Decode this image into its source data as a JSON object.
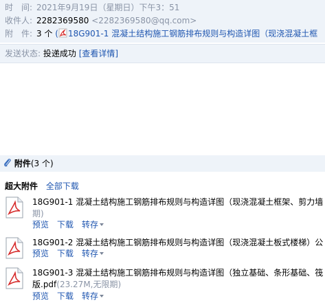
{
  "header": {
    "time_label": "时　间:",
    "time_value": "2021年9月19日（星期日）下午3：51",
    "to_label": "收件人:",
    "to_name": "2282369580",
    "to_addr": "<2282369580@qq.com>",
    "attach_label": "附　件:",
    "attach_count": "3 个",
    "attach_paren": "(",
    "attach_first": "18G901-1 混凝土结构施工钢筋排布规则与构造详图（现浇混凝土框"
  },
  "status": {
    "label": "发送状态:",
    "value": "投递成功",
    "link": "[查看详情]"
  },
  "attachments": {
    "title": "附件",
    "count": "(3 个)",
    "section": "超大附件",
    "download_all": "全部下载",
    "files": [
      {
        "name": "18G901-1 混凝土结构施工钢筋排布规则与构造详图（现浇混凝土框架、剪力墙",
        "cont": "期)",
        "preview": "预览",
        "download": "下载",
        "forward": "转存"
      },
      {
        "name": "18G901-2 混凝土结构施工钢筋排布规则与构造详图（现浇混凝土板式楼梯）公",
        "preview": "预览",
        "download": "下载",
        "forward": "转存"
      },
      {
        "name": "18G901-3 混凝土结构施工钢筋排布规则与构造详图（独立基础、条形基础、筏",
        "cont_name": "版.pdf",
        "cont_meta": "(23.27M,无限期)",
        "preview": "预览",
        "download": "下载",
        "forward": "转存"
      }
    ]
  },
  "colors": {
    "header_bg": "#eef3f9",
    "link": "#1f56b0",
    "label": "#8a94a6",
    "pdf_red": "#d62b2b"
  }
}
